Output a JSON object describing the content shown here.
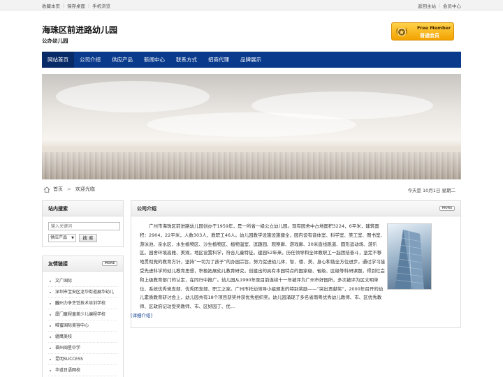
{
  "topbar": {
    "left_links": [
      "收藏本页",
      "保存桌面",
      "手机浏览"
    ],
    "right_links": [
      "返回主站",
      "会员中心"
    ]
  },
  "header": {
    "title": "海珠区前进路幼儿园",
    "subtitle": "公办幼儿园",
    "member_badge": {
      "en": "Free Member",
      "zh": "普通会员"
    }
  },
  "nav": {
    "items": [
      "网站首页",
      "公司介绍",
      "供应产品",
      "新闻中心",
      "联系方式",
      "招商代理",
      "品牌展示"
    ],
    "active_index": 0
  },
  "breadcrumb": {
    "home": "首页",
    "current": "欢迎光临"
  },
  "date": "今天是 10月1日 星期二",
  "sidebar": {
    "search": {
      "title": "站内搜索",
      "placeholder": "输入关键词",
      "select_value": "供应产品",
      "button": "搜 索"
    },
    "links": {
      "title": "友情链接",
      "more": "MORE",
      "items": [
        "文广国际",
        "深圳市宝安区龙华街道展华幼儿园",
        "苏州力争烹饪技术培训学校",
        "厦门童程童美少儿编程学校",
        "唯蜜国际美容中心",
        "疆鹰美校",
        "福州闽星中学",
        "昆明SUCCESS",
        "华道日语网校"
      ]
    }
  },
  "main": {
    "title": "公司介绍",
    "more": "MORE",
    "body": "广州市海珠区前进路幼儿园创办于1959年，是一所省一级公立幼儿园。现有园舍中占地面积3224，6平米，建筑面积：2904，22平米，人数303人，教职工46人。幼儿园教学设施设施健全，园内设有音体室、科学室、美工室、图书室、游泳池、亲水区、水生植物区、沙生植物区、植物温室、逗趣园、观察廊、游戏廊、30米直线跑道、圆形运动场、游乐区。园舍环境高雅、美观，地区设置科学，符合儿童特征。建园52年来，历任领导和全体教职工一起团结奋斗，坚定不移地贯彻党的教育方针，坚持“一切为了孩子”的办园宗旨，努力促进幼儿体、智、德、美、身心和谐全方位进步。通过学习接受先进科学的幼儿教育思想，积极拓展幼儿教育研究，创建出的具有本园特点的国家级、省级、区级等科研课题，得到社会和上级教育部门的认定，在同行中推广。幼儿园从1990年至目前连续十一年被评为广州市好园所，多次被评为区文明单位、系统优秀党支部、优秀团支部、职工之家。广州市托幼领导小组颁发的特别奖励——“突出贡献奖”，2000年召开的幼儿素质教育研讨会上，幼儿园共有18个项目获奖并获优秀组织奖。幼儿园涌现了多名省雨粤优秀幼儿教师、市、区优秀教师、区政府记功受奖教师、市、区好园丁、优...",
    "more_link": "[详细介绍]"
  }
}
